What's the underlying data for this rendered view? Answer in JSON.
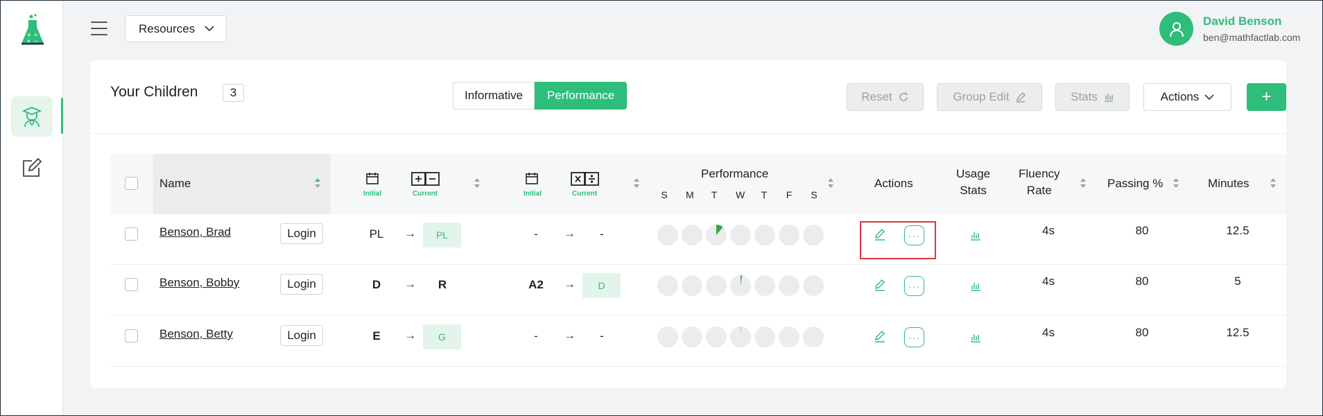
{
  "header": {
    "resources_label": "Resources",
    "user_name": "David Benson",
    "user_email": "ben@mathfactlab.com"
  },
  "card": {
    "title": "Your Children",
    "count": "3",
    "view_toggle": {
      "informative": "Informative",
      "performance": "Performance",
      "active": "Performance"
    },
    "toolbar": {
      "reset": "Reset",
      "group_edit": "Group Edit",
      "stats": "Stats",
      "actions": "Actions",
      "add": "+"
    }
  },
  "table": {
    "headers": {
      "name": "Name",
      "initial": "Initial",
      "current": "Current",
      "performance": "Performance",
      "days": [
        "S",
        "M",
        "T",
        "W",
        "T",
        "F",
        "S"
      ],
      "actions": "Actions",
      "usage_stats_1": "Usage",
      "usage_stats_2": "Stats",
      "fluency_1": "Fluency",
      "fluency_2": "Rate",
      "passing": "Passing %",
      "minutes": "Minutes"
    },
    "rows": [
      {
        "name": "Benson, Brad",
        "login": "Login",
        "add_initial": "PL",
        "add_current": "PL",
        "mul_initial": "-",
        "mul_current": "-",
        "fluency": "4s",
        "passing": "80",
        "minutes": "12.5"
      },
      {
        "name": "Benson, Bobby",
        "login": "Login",
        "add_initial": "D",
        "add_current": "R",
        "mul_initial": "A2",
        "mul_current": "D",
        "fluency": "4s",
        "passing": "80",
        "minutes": "5"
      },
      {
        "name": "Benson, Betty",
        "login": "Login",
        "add_initial": "E",
        "add_current": "G",
        "mul_initial": "-",
        "mul_current": "-",
        "fluency": "4s",
        "passing": "80",
        "minutes": "12.5"
      }
    ],
    "arrow": "→",
    "more": "···"
  },
  "colors": {
    "accent": "#2ebd7a",
    "highlight": "#d9363e"
  }
}
